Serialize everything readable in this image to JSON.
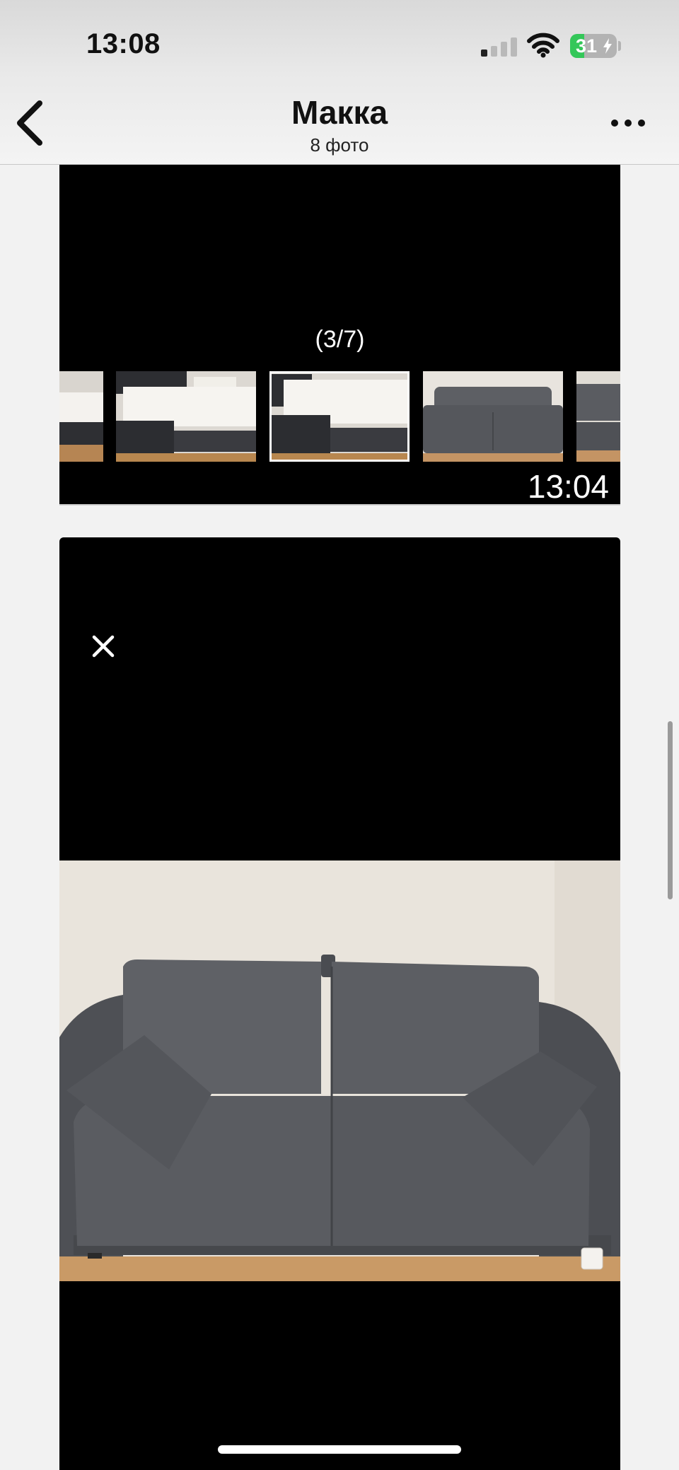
{
  "status_bar": {
    "time": "13:08",
    "battery_percent": "31",
    "battery_charging": true,
    "signal_bars_active": 1,
    "wifi_icon": "wifi-icon"
  },
  "nav": {
    "title": "Макка",
    "subtitle": "8 фото",
    "back_icon": "chevron-left-icon",
    "more_icon": "ellipsis-icon"
  },
  "viewer_card": {
    "counter": "(3/7)",
    "timestamp": "13:04",
    "selected_thumbnail_index": 2,
    "thumbnails": [
      {
        "subject": "sofa-bed-unfolded-partial"
      },
      {
        "subject": "sofa-bed-unfolded"
      },
      {
        "subject": "sofa-bed-unfolded"
      },
      {
        "subject": "grey-sofa-folded"
      },
      {
        "subject": "sofa-partial"
      }
    ]
  },
  "photo_card": {
    "close_icon": "close-icon",
    "photo_subject": "grey-two-seat-sofa-with-cushions"
  },
  "colors": {
    "sofa": "#55575c",
    "wall": "#e9e4dc",
    "floor": "#c99a66",
    "battery_fill": "#34c759"
  }
}
